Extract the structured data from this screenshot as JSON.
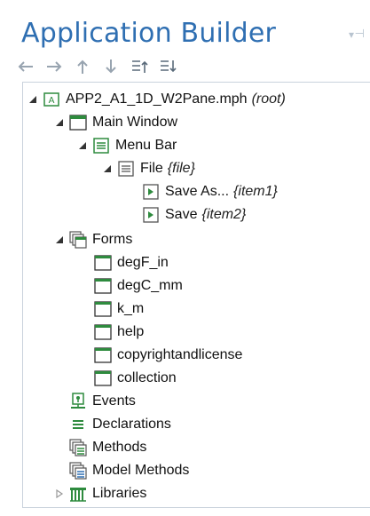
{
  "panel": {
    "title": "Application Builder"
  },
  "toolbar": {
    "buttons": [
      "back-icon",
      "forward-icon",
      "up-icon",
      "down-icon",
      "move-up-list-icon",
      "move-down-list-icon"
    ]
  },
  "tree": {
    "root": {
      "label": "APP2_A1_1D_W2Pane.mph",
      "tag": "(root)"
    },
    "main_window": {
      "label": "Main Window"
    },
    "menu_bar": {
      "label": "Menu Bar"
    },
    "file": {
      "label": "File",
      "tag": "{file}"
    },
    "save_as": {
      "label": "Save As...",
      "tag": "{item1}"
    },
    "save": {
      "label": "Save",
      "tag": "{item2}"
    },
    "forms": {
      "label": "Forms"
    },
    "form_items": [
      "degF_in",
      "degC_mm",
      "k_m",
      "help",
      "copyrightandlicense",
      "collection"
    ],
    "events": {
      "label": "Events"
    },
    "declarations": {
      "label": "Declarations"
    },
    "methods": {
      "label": "Methods"
    },
    "model_methods": {
      "label": "Model Methods"
    },
    "libraries": {
      "label": "Libraries"
    }
  },
  "colors": {
    "title": "#2f6fb2",
    "icon_green": "#2e8b3e",
    "toolbar_gray": "#98a4b0"
  }
}
